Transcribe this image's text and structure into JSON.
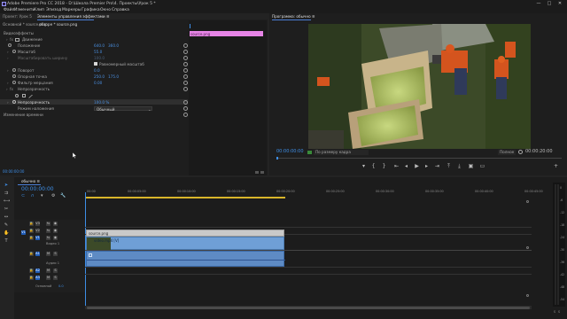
{
  "window": {
    "title": "Adobe Premiere Pro CC 2018 - D:\\Школа Premier Pro\\4. Проекты\\Урок 5 *",
    "minimize_glyph": "—",
    "maximize_glyph": "□",
    "close_glyph": "✕"
  },
  "menu": [
    "Файл",
    "Изменить",
    "Клип",
    "Эпизод",
    "Маркеры",
    "Графика",
    "Окно",
    "Справка"
  ],
  "left_panel": {
    "tabs": [
      "Проект: Урок 5",
      "Элементы управления эффектами ≡",
      "Источник: * source.png",
      "Аудиомикшер"
    ],
    "source_line": "Основной * source.png",
    "clip_tab": "обзоре * source.png",
    "clip_bar_label": "source.png",
    "section": "Видеоэффекты",
    "motion": "Движение",
    "position_label": "Положение",
    "position_x": "640.0",
    "position_y": "360.0",
    "scale_label": "Масштаб",
    "scale_value": "55.0",
    "scale_width_label": "Масштабировать ширину",
    "scale_width_value": "100.0",
    "uniform_scale_label": "Равномерный масштаб",
    "rotation_label": "Поворот",
    "rotation_value": "0.0",
    "anchor_label": "Опорная точка",
    "anchor_x": "250.0",
    "anchor_y": "175.0",
    "antiflicker_label": "Фильтр мерцания",
    "antiflicker_value": "0.00",
    "opacity_section": "Непрозрачность",
    "opacity_label": "Непрозрачность",
    "opacity_value": "100.0 %",
    "blend_label": "Режим наложения",
    "blend_value": "Обычный",
    "time_remap": "Изменение времени",
    "timecode": "00:00:00:00"
  },
  "program": {
    "title": "Программа: обычно ≡",
    "timecode_left": "00:00:00:00",
    "fit": "По размеру кадра",
    "quality": "Полное",
    "timecode_right": "00:00:20:00"
  },
  "timeline": {
    "tab": "обычно ≡",
    "timecode": "00:00:00:00",
    "ruler": [
      "00:00",
      "00:00:05:00",
      "00:00:10:00",
      "00:00:15:00",
      "00:00:20:00",
      "00:00:25:00",
      "00:00:30:00",
      "00:00:35:00",
      "00:00:40:00",
      "00:00:45:00"
    ],
    "tracks_v": [
      "V3",
      "V2",
      "V1"
    ],
    "tracks_a": [
      "A1",
      "A2",
      "A3"
    ],
    "v1_name": "Видео 1",
    "a1_name": "Аудио 1",
    "master_label": "Основной",
    "master_value": "0.0",
    "clip_v2": "source.png",
    "clip_v1": "video.mp4 [V]"
  },
  "meters": {
    "ticks": [
      "0",
      "-6",
      "-12",
      "-18",
      "-24",
      "-30",
      "-36",
      "-42",
      "-48",
      "-54"
    ],
    "label_left": "S",
    "label_right": "S"
  },
  "colors": {
    "accent": "#3e8ee6",
    "clip_pink": "#e785e7",
    "clip_video": "#6f9fd6",
    "clip_audio": "#5e8bc4"
  }
}
